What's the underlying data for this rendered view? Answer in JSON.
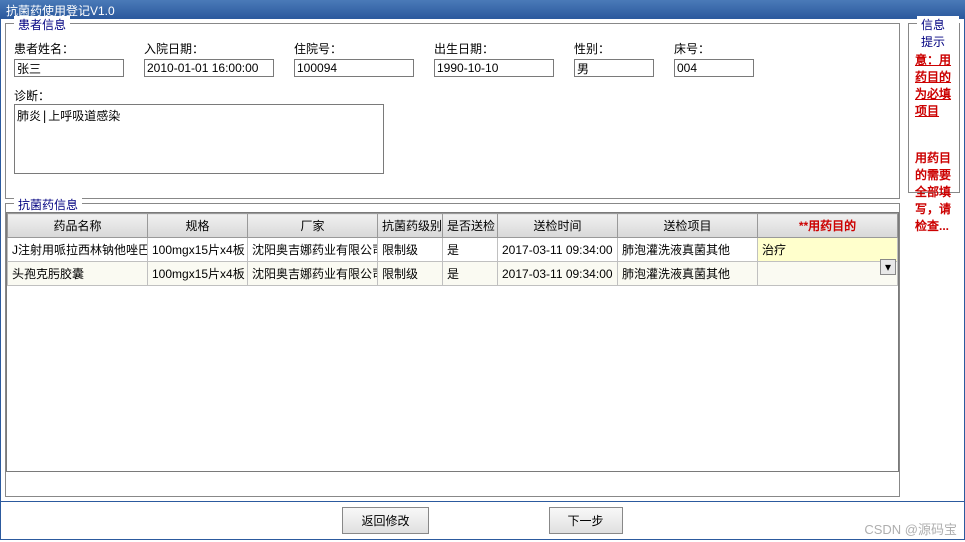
{
  "window": {
    "title": "抗菌药使用登记V1.0"
  },
  "patient_section": {
    "legend": "患者信息",
    "fields": {
      "name_label": "患者姓名：",
      "name_value": "张三",
      "admit_label": "入院日期：",
      "admit_value": "2010-01-01 16:00:00",
      "hosp_label": "住院号：",
      "hosp_value": "100094",
      "birth_label": "出生日期：",
      "birth_value": "1990-10-10",
      "sex_label": "性别：",
      "sex_value": "男",
      "bed_label": "床号：",
      "bed_value": "004",
      "diag_label": "诊断：",
      "diag_value": "肺炎|上呼吸道感染"
    }
  },
  "tips": {
    "legend": "信息提示",
    "notice": "注意：用药目的为必填项目",
    "message": "用药目的需要全部填写，请检查..."
  },
  "drug_section": {
    "legend": "抗菌药信息"
  },
  "table": {
    "headers": [
      "药品名称",
      "规格",
      "厂家",
      "抗菌药级别",
      "是否送检",
      "送检时间",
      "送检项目",
      "**用药目的"
    ],
    "rows": [
      {
        "name": "J注射用哌拉西林钠他唑巴坦钠",
        "spec": "100mgx15片x4板",
        "mfr": "沈阳奥吉娜药业有限公司",
        "level": "限制级",
        "sent": "是",
        "time": "2017-03-11 09:34:00",
        "item": "肺泡灌洗液真菌其他",
        "purpose": "治疗"
      },
      {
        "name": "头孢克肟胶囊",
        "spec": "100mgx15片x4板",
        "mfr": "沈阳奥吉娜药业有限公司",
        "level": "限制级",
        "sent": "是",
        "time": "2017-03-11 09:34:00",
        "item": "肺泡灌洗液真菌其他",
        "purpose": ""
      }
    ]
  },
  "buttons": {
    "back": "返回修改",
    "next": "下一步"
  },
  "watermark": "CSDN @源码宝"
}
